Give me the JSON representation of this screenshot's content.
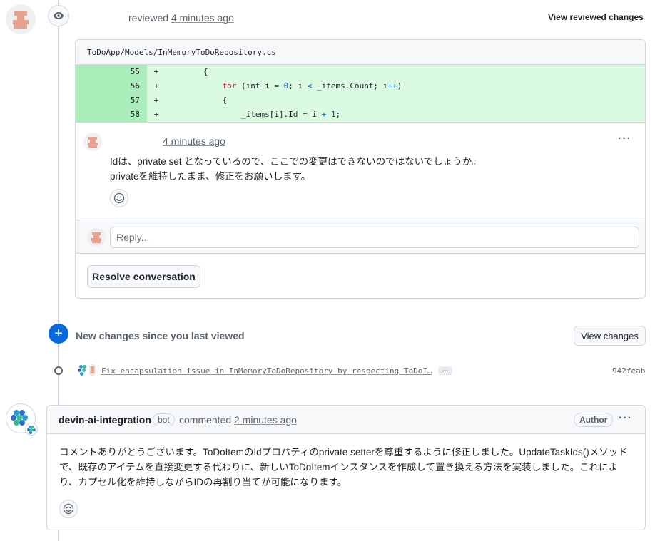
{
  "review_event": {
    "action": "reviewed",
    "time": "4 minutes ago",
    "view_button": "View reviewed changes"
  },
  "file": {
    "path": "ToDoApp/Models/InMemoryToDoRepository.cs",
    "lines": [
      {
        "num": "55",
        "sign": "+",
        "indent": "        ",
        "tokens": [
          {
            "t": "{",
            "c": ""
          }
        ]
      },
      {
        "num": "56",
        "sign": "+",
        "indent": "            ",
        "tokens": [
          {
            "t": "for",
            "c": "kw"
          },
          {
            "t": " (int i ",
            "c": ""
          },
          {
            "t": "=",
            "c": "op"
          },
          {
            "t": " ",
            "c": ""
          },
          {
            "t": "0",
            "c": "num"
          },
          {
            "t": "; i ",
            "c": ""
          },
          {
            "t": "<",
            "c": "op"
          },
          {
            "t": " _items.Count; i",
            "c": ""
          },
          {
            "t": "++",
            "c": "op"
          },
          {
            "t": ")",
            "c": ""
          }
        ]
      },
      {
        "num": "57",
        "sign": "+",
        "indent": "            ",
        "tokens": [
          {
            "t": "{",
            "c": ""
          }
        ]
      },
      {
        "num": "58",
        "sign": "+",
        "indent": "                ",
        "tokens": [
          {
            "t": "_items[i].Id ",
            "c": ""
          },
          {
            "t": "=",
            "c": "op"
          },
          {
            "t": " i ",
            "c": ""
          },
          {
            "t": "+",
            "c": "op"
          },
          {
            "t": " ",
            "c": ""
          },
          {
            "t": "1",
            "c": "num"
          },
          {
            "t": ";",
            "c": ""
          }
        ]
      }
    ]
  },
  "review_comment": {
    "time": "4 minutes ago",
    "line1": "Idは、private set となっているので、ここでの変更はできないのではないでしょうか。",
    "line2": "privateを維持したまま、修正をお願いします。"
  },
  "reply": {
    "placeholder": "Reply..."
  },
  "resolve_button": "Resolve conversation",
  "new_changes": {
    "label": "New changes since you last viewed",
    "button": "View changes"
  },
  "commit": {
    "message": "Fix encapsulation issue in InMemoryToDoRepository by respecting ToDoI…",
    "ellipsis": "…",
    "sha": "942feab"
  },
  "bot_comment": {
    "author": "devin-ai-integration",
    "badge": "bot",
    "action": "commented",
    "time": "2 minutes ago",
    "role": "Author",
    "body": "コメントありがとうございます。ToDoItemのIdプロパティのprivate setterを尊重するように修正しました。UpdateTaskIds()メソッドで、既存のアイテムを直接変更する代わりに、新しいToDoItemインスタンスを作成して置き換える方法を実装しました。これにより、カプセル化を維持しながらIDの再割り当てが可能になります。"
  },
  "colors": {
    "diff_added_bg": "#dafbe1",
    "diff_added_num_bg": "#aceebb",
    "accent_blue": "#0969da",
    "keyword_red": "#cf222e"
  }
}
